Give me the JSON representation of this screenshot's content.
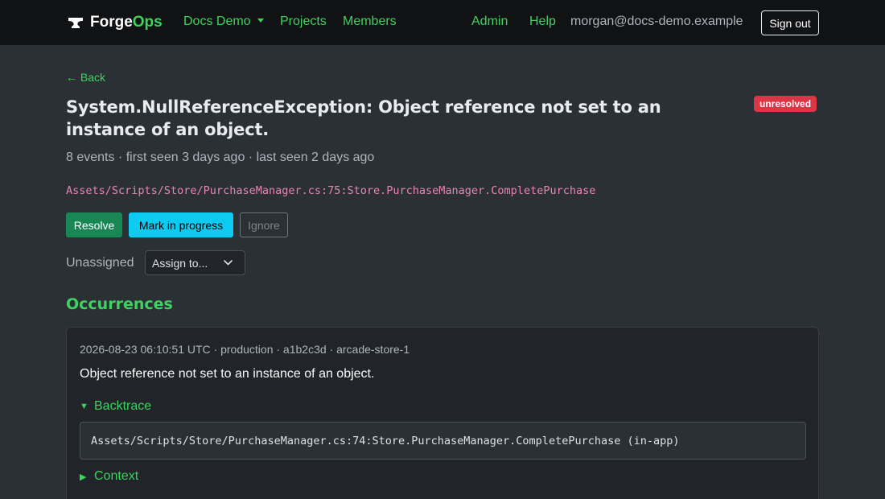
{
  "navbar": {
    "brand_forge": "Forge",
    "brand_ops": "Ops",
    "project_menu": "Docs Demo",
    "projects": "Projects",
    "members": "Members",
    "admin": "Admin",
    "help": "Help",
    "user_email": "morgan@docs-demo.example",
    "sign_out": "Sign out",
    "accent_color": "#3dd35f"
  },
  "issue": {
    "back_label": "← Back",
    "title": "System.NullReferenceException: Object reference not set to an instance of an object.",
    "status": "unresolved",
    "status_color": "#dc3545",
    "meta": "8 events · first seen 3 days ago · last seen 2 days ago",
    "culprit": "Assets/Scripts/Store/PurchaseManager.cs:75:Store.PurchaseManager.CompletePurchase",
    "actions": {
      "resolve": "Resolve",
      "in_progress": "Mark in progress",
      "ignore": "Ignore"
    },
    "assignee_label": "Unassigned",
    "assign_select": "Assign to..."
  },
  "occurrences": {
    "title": "Occurrences",
    "items": [
      {
        "meta": "2026-08-23 06:10:51 UTC · production · a1b2c3d · arcade-store-1",
        "message": "Object reference not set to an instance of an object.",
        "backtrace_label": "Backtrace",
        "backtrace_expanded": true,
        "backtrace_line": "Assets/Scripts/Store/PurchaseManager.cs:74:Store.PurchaseManager.CompletePurchase (in-app)",
        "context_label": "Context",
        "context_expanded": false
      }
    ]
  }
}
